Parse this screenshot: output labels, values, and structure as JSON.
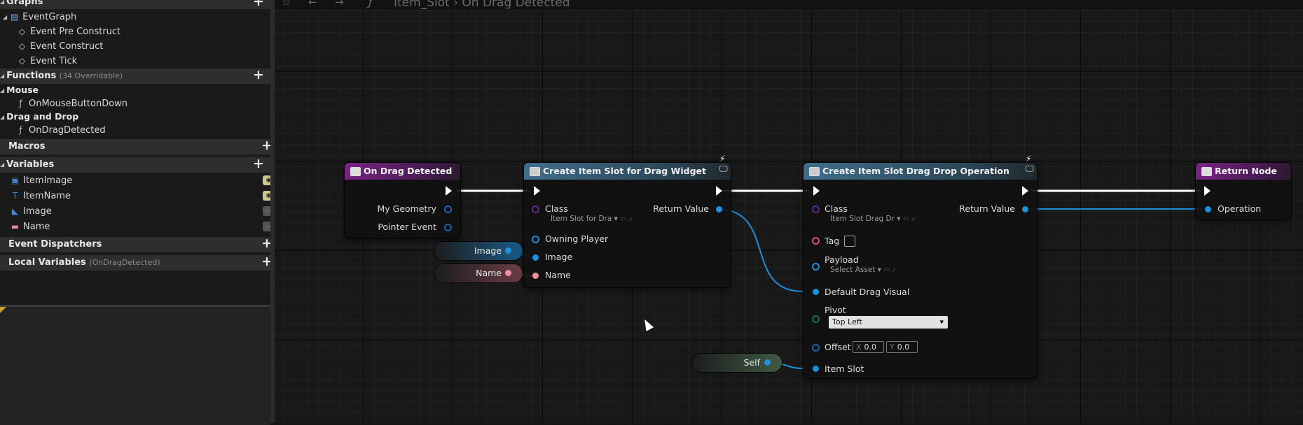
{
  "left_panel": {
    "graphs": {
      "header": "Graphs",
      "items": [
        "EventGraph",
        "Event Pre Construct",
        "Event Construct",
        "Event Tick"
      ]
    },
    "functions": {
      "header": "Functions",
      "hint": "(34 Overridable)",
      "categories": [
        {
          "name": "Mouse",
          "items": [
            "OnMouseButtonDown"
          ]
        },
        {
          "name": "Drag and Drop",
          "items": [
            "OnDragDetected"
          ]
        }
      ]
    },
    "macros": {
      "header": "Macros"
    },
    "variables": {
      "header": "Variables",
      "items": [
        {
          "name": "ItemImage",
          "icon": "image-var-icon",
          "color": "#3f88d6"
        },
        {
          "name": "ItemName",
          "icon": "text-var-icon",
          "color": "#3f88d6"
        },
        {
          "name": "Image",
          "icon": "widget-var-icon",
          "color": "#3f88d6"
        },
        {
          "name": "Name",
          "icon": "text-pill-icon",
          "color": "#e8839b"
        }
      ]
    },
    "event_dispatchers": {
      "header": "Event Dispatchers"
    },
    "local_variables": {
      "header": "Local Variables",
      "hint": "(OnDragDetected)"
    }
  },
  "breadcrumb": {
    "blueprint": "Item_Slot",
    "graph": "On Drag Detected"
  },
  "nodes": {
    "on_drag_detected": {
      "title": "On Drag Detected",
      "outputs": [
        "My Geometry",
        "Pointer Event"
      ]
    },
    "create_widget": {
      "title": "Create Item Slot for Drag Widget",
      "class_label": "Class",
      "class_value": "Item Slot for Dra",
      "return_label": "Return Value",
      "inputs": [
        "Owning Player",
        "Image",
        "Name"
      ]
    },
    "create_drag_drop": {
      "title": "Create Item Slot Drag Drop Operation",
      "class_label": "Class",
      "class_value": "Item Slot Drag Dr",
      "return_label": "Return Value",
      "tag_label": "Tag",
      "payload_label": "Payload",
      "payload_value": "Select Asset",
      "default_drag_visual_label": "Default Drag Visual",
      "pivot_label": "Pivot",
      "pivot_value": "Top Left",
      "offset_label": "Offset",
      "offset_x": "0.0",
      "offset_y": "0.0",
      "offset_x_axis": "X",
      "offset_y_axis": "Y",
      "item_slot_label": "Item Slot"
    },
    "return_node": {
      "title": "Return Node",
      "input": "Operation"
    },
    "getters": {
      "image": "Image",
      "name": "Name",
      "self": "Self"
    }
  },
  "colors": {
    "event_header": "#7a2384",
    "function_header": "#3f6e8c",
    "object_pin": "#1e90e0",
    "text_pin": "#f08fa4",
    "class_pin": "#5b2a92",
    "struct_pin": "#1f5fb0",
    "tag_pin": "#e0438b",
    "wire_object": "#1e8fd8"
  }
}
